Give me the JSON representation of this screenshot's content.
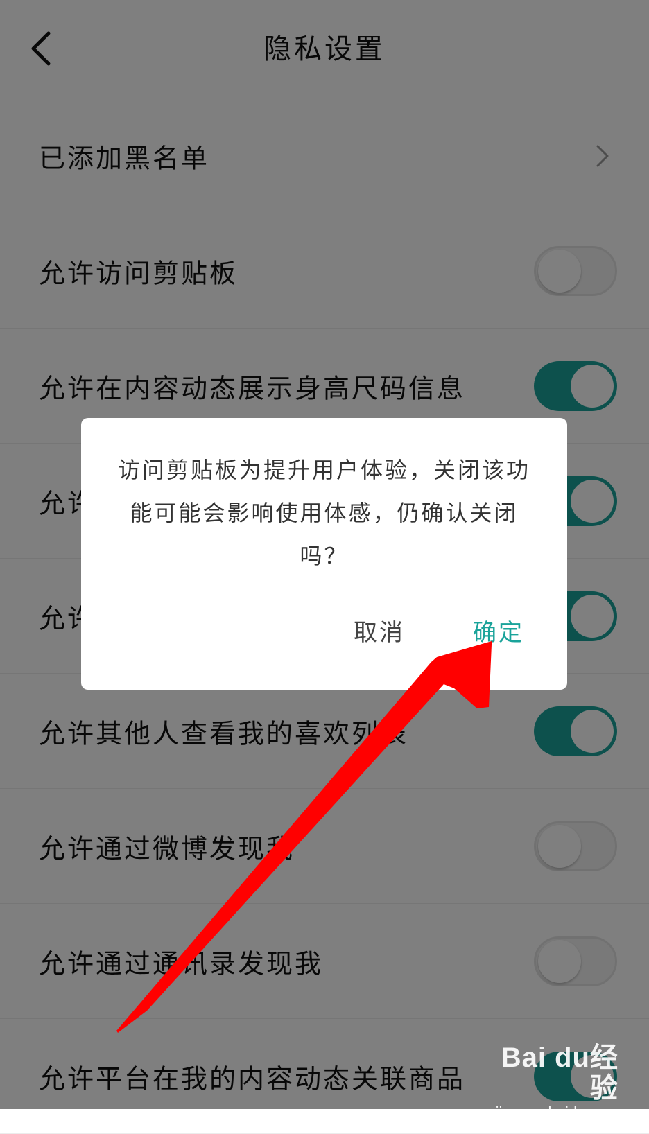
{
  "header": {
    "title": "隐私设置",
    "back_icon": "chevron-left-icon"
  },
  "settings": [
    {
      "label": "已添加黑名单",
      "control": "chevron"
    },
    {
      "label": "允许访问剪贴板",
      "control": "toggle",
      "on": false
    },
    {
      "label": "允许在内容动态展示身高尺码信息",
      "control": "toggle",
      "on": true
    },
    {
      "label": "允许",
      "control": "toggle",
      "on": true
    },
    {
      "label": "允许",
      "control": "toggle",
      "on": true
    },
    {
      "label": "允许其他人查看我的喜欢列表",
      "control": "toggle",
      "on": true
    },
    {
      "label": "允许通过微博发现我",
      "control": "toggle",
      "on": false
    },
    {
      "label": "允许通过通讯录发现我",
      "control": "toggle",
      "on": false
    },
    {
      "label": "允许平台在我的内容动态关联商品",
      "control": "toggle",
      "on": true
    }
  ],
  "dialog": {
    "message": "访问剪贴板为提升用户体验，关闭该功能可能会影响使用体感，仍确认关闭吗？",
    "cancel_label": "取消",
    "confirm_label": "确定"
  },
  "watermark": {
    "logo": "Bai du经验",
    "url": "jingyan.baidu.com"
  },
  "colors": {
    "accent": "#1aa39a",
    "annotation_arrow": "#ff0000",
    "overlay": "rgba(0,0,0,0.5)"
  }
}
